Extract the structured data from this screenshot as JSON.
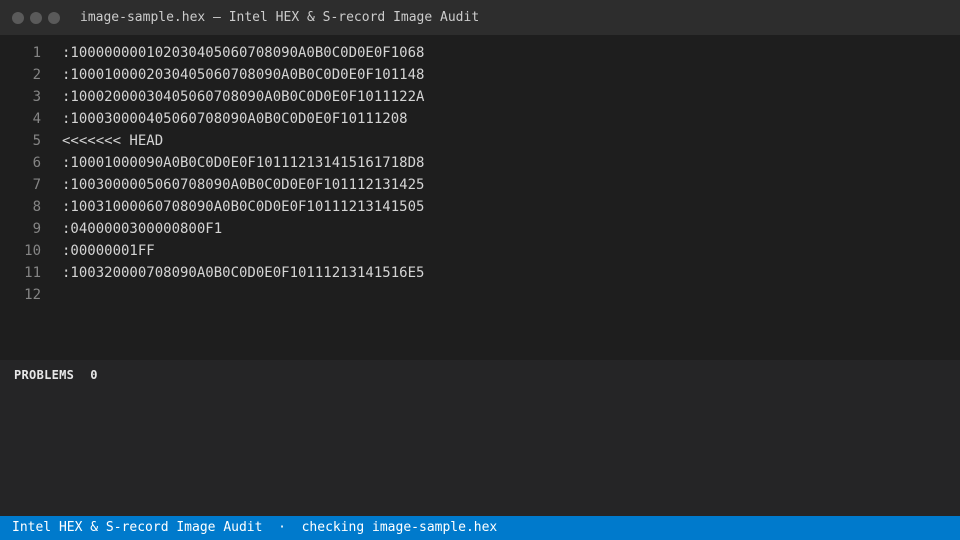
{
  "window": {
    "title": "image-sample.hex — Intel HEX & S-record Image Audit"
  },
  "editor": {
    "lines": [
      {
        "num": "1",
        "text": ":10000000010203040506070809 0A0B0C0D0E0F1068"
      },
      {
        "num": "2",
        "text": ":10001000020304050607080 90A0B0C0D0E0F101148"
      },
      {
        "num": "3",
        "text": ":1000200003040506070809 0A0B0C0D0E0F1011122A"
      },
      {
        "num": "4",
        "text": ":10003000040506070809 0A0B0C0D0E0F10111208"
      },
      {
        "num": "5",
        "text": "<<<<<<< HEAD"
      },
      {
        "num": "6",
        "text": ":10001000090A0B0C0D0E0F101112131415161718D8"
      },
      {
        "num": "7",
        "text": ":10030000050607080 90A0B0C0D0E0F101112131425"
      },
      {
        "num": "8",
        "text": ":100310000607080 90A0B0C0D0E0F10111213141505"
      },
      {
        "num": "9",
        "text": ":0400000300000800F1"
      },
      {
        "num": "10",
        "text": ":00000001FF"
      },
      {
        "num": "11",
        "text": ":100320000708090A0B0C0D0E0F10111213141516E5"
      },
      {
        "num": "12",
        "text": ""
      }
    ]
  },
  "panel": {
    "label": "PROBLEMS",
    "count": "0"
  },
  "statusbar": {
    "app_name": "Intel HEX & S-record Image Audit",
    "separator": " · ",
    "status_text": "checking image-sample.hex"
  }
}
